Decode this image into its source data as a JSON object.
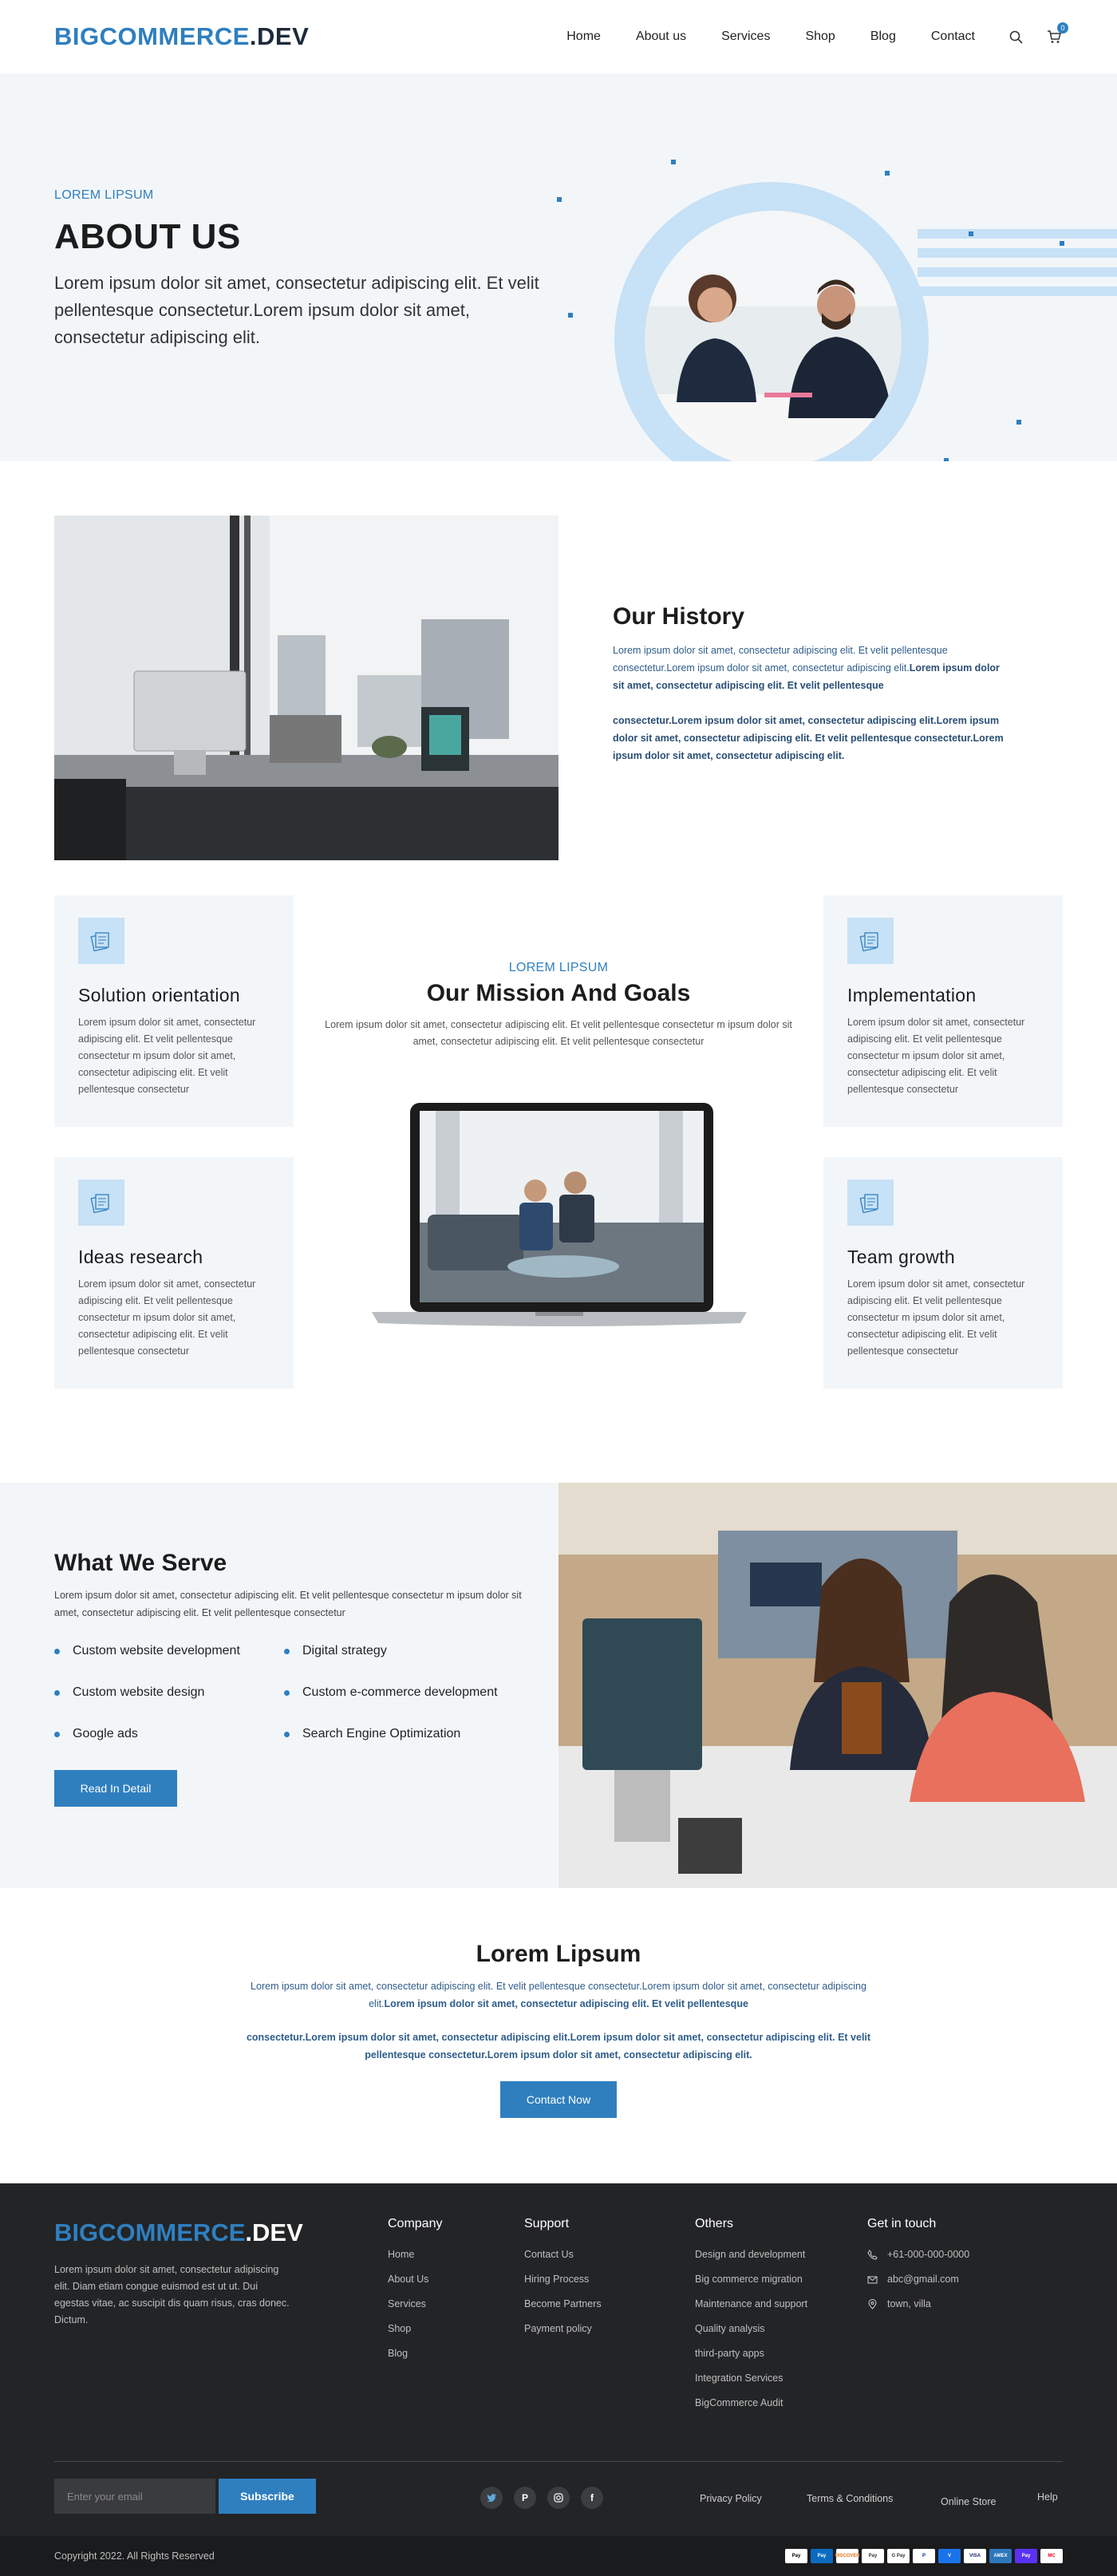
{
  "header": {
    "logo_part1": "BIGCOMMERCE",
    "logo_part2": ".DEV",
    "nav": [
      "Home",
      "About us",
      "Services",
      "Shop",
      "Blog",
      "Contact"
    ],
    "cart_count": "0"
  },
  "hero": {
    "kicker": "LOREM LIPSUM",
    "title": "ABOUT US",
    "lead": "Lorem ipsum dolor sit amet, consectetur adipiscing elit. Et velit pellentesque consectetur.Lorem ipsum dolor sit amet, consectetur adipiscing elit."
  },
  "history": {
    "title": "Our History",
    "p1_normal": "Lorem ipsum dolor sit amet, consectetur adipiscing elit. Et velit pellentesque consectetur.Lorem ipsum dolor sit amet, consectetur adipiscing elit.",
    "p1_bold": "Lorem ipsum dolor sit amet, consectetur adipiscing elit. Et velit pellentesque",
    "p2": "consectetur.Lorem ipsum dolor sit amet, consectetur adipiscing elit.Lorem ipsum dolor sit amet, consectetur adipiscing elit. Et velit pellentesque consectetur.Lorem ipsum dolor sit amet, consectetur adipiscing elit."
  },
  "mission": {
    "kicker": "LOREM LIPSUM",
    "title": "Our Mission And Goals",
    "desc": "Lorem ipsum dolor sit amet, consectetur adipiscing elit. Et velit pellentesque consectetur  m ipsum dolor sit amet, consectetur adipiscing elit. Et velit pellentesque consectetur",
    "cards": [
      {
        "title": "Solution orientation",
        "text": "Lorem ipsum dolor sit amet, consectetur adipiscing elit. Et velit pellentesque consectetur  m ipsum dolor sit amet, consectetur adipiscing elit. Et velit pellentesque consectetur"
      },
      {
        "title": "Implementation",
        "text": "Lorem ipsum dolor sit amet, consectetur adipiscing elit. Et velit pellentesque consectetur  m ipsum dolor sit amet, consectetur adipiscing elit. Et velit pellentesque consectetur"
      },
      {
        "title": "Ideas research",
        "text": "Lorem ipsum dolor sit amet, consectetur adipiscing elit. Et velit pellentesque consectetur  m ipsum dolor sit amet, consectetur adipiscing elit. Et velit pellentesque consectetur"
      },
      {
        "title": "Team growth",
        "text": "Lorem ipsum dolor sit amet, consectetur adipiscing elit. Et velit pellentesque consectetur  m ipsum dolor sit amet, consectetur adipiscing elit. Et velit pellentesque consectetur"
      }
    ]
  },
  "serve": {
    "title": "What We Serve",
    "desc": "Lorem ipsum dolor sit amet, consectetur adipiscing elit. Et velit pellentesque consectetur  m ipsum dolor sit amet, consectetur adipiscing elit. Et velit pellentesque consectetur",
    "items": [
      "Custom website development",
      "Digital strategy",
      "Custom website design",
      "Custom e-commerce development",
      "Google ads",
      "Search Engine Optimization"
    ],
    "button": "Read In Detail"
  },
  "lorem": {
    "title": "Lorem Lipsum",
    "p1_normal": "Lorem ipsum dolor sit amet, consectetur adipiscing elit. Et velit pellentesque consectetur.Lorem ipsum dolor sit amet, consectetur adipiscing elit.",
    "p1_bold": "Lorem ipsum dolor sit amet, consectetur adipiscing elit. Et velit pellentesque",
    "p2": "consectetur.Lorem ipsum dolor sit amet, consectetur adipiscing elit.Lorem ipsum dolor sit amet, consectetur adipiscing elit. Et velit pellentesque consectetur.Lorem ipsum dolor sit amet, consectetur adipiscing elit.",
    "button": "Contact Now"
  },
  "footer": {
    "logo_part1": "BIGCOMMERCE",
    "logo_part2": ".DEV",
    "about": "Lorem ipsum dolor sit amet, consectetur adipiscing elit. Diam etiam congue euismod est ut ut. Dui egestas vitae, ac suscipit dis quam risus, cras donec. Dictum.",
    "company": {
      "title": "Company",
      "links": [
        "Home",
        "About  Us",
        "Services",
        "Shop",
        "Blog"
      ]
    },
    "support": {
      "title": "Support",
      "links": [
        "Contact Us",
        "Hiring Process",
        "Become Partners",
        "Payment policy"
      ]
    },
    "others": {
      "title": "Others",
      "links": [
        "Design and development",
        "Big commerce migration",
        "Maintenance and support",
        "Quality analysis",
        "third-party apps",
        "Integration Services",
        "BigCommerce Audit"
      ]
    },
    "contact": {
      "title": "Get in touch",
      "phone": "+61-000-000-0000",
      "email": "abc@gmail.com",
      "address": "town, villa"
    },
    "email_placeholder": "Enter your email",
    "subscribe": "Subscribe",
    "bottom_links": [
      "Privacy Policy",
      "Terms & Conditions",
      "Online Store",
      "Help"
    ],
    "copyright": "Copyright 2022. All Rights Reserved",
    "payments": [
      "Pay",
      "Pay",
      "DISCOVER",
      "Pay",
      "G Pay",
      "P",
      "V",
      "VISA",
      "AMEX",
      "Pay",
      "MC"
    ]
  }
}
